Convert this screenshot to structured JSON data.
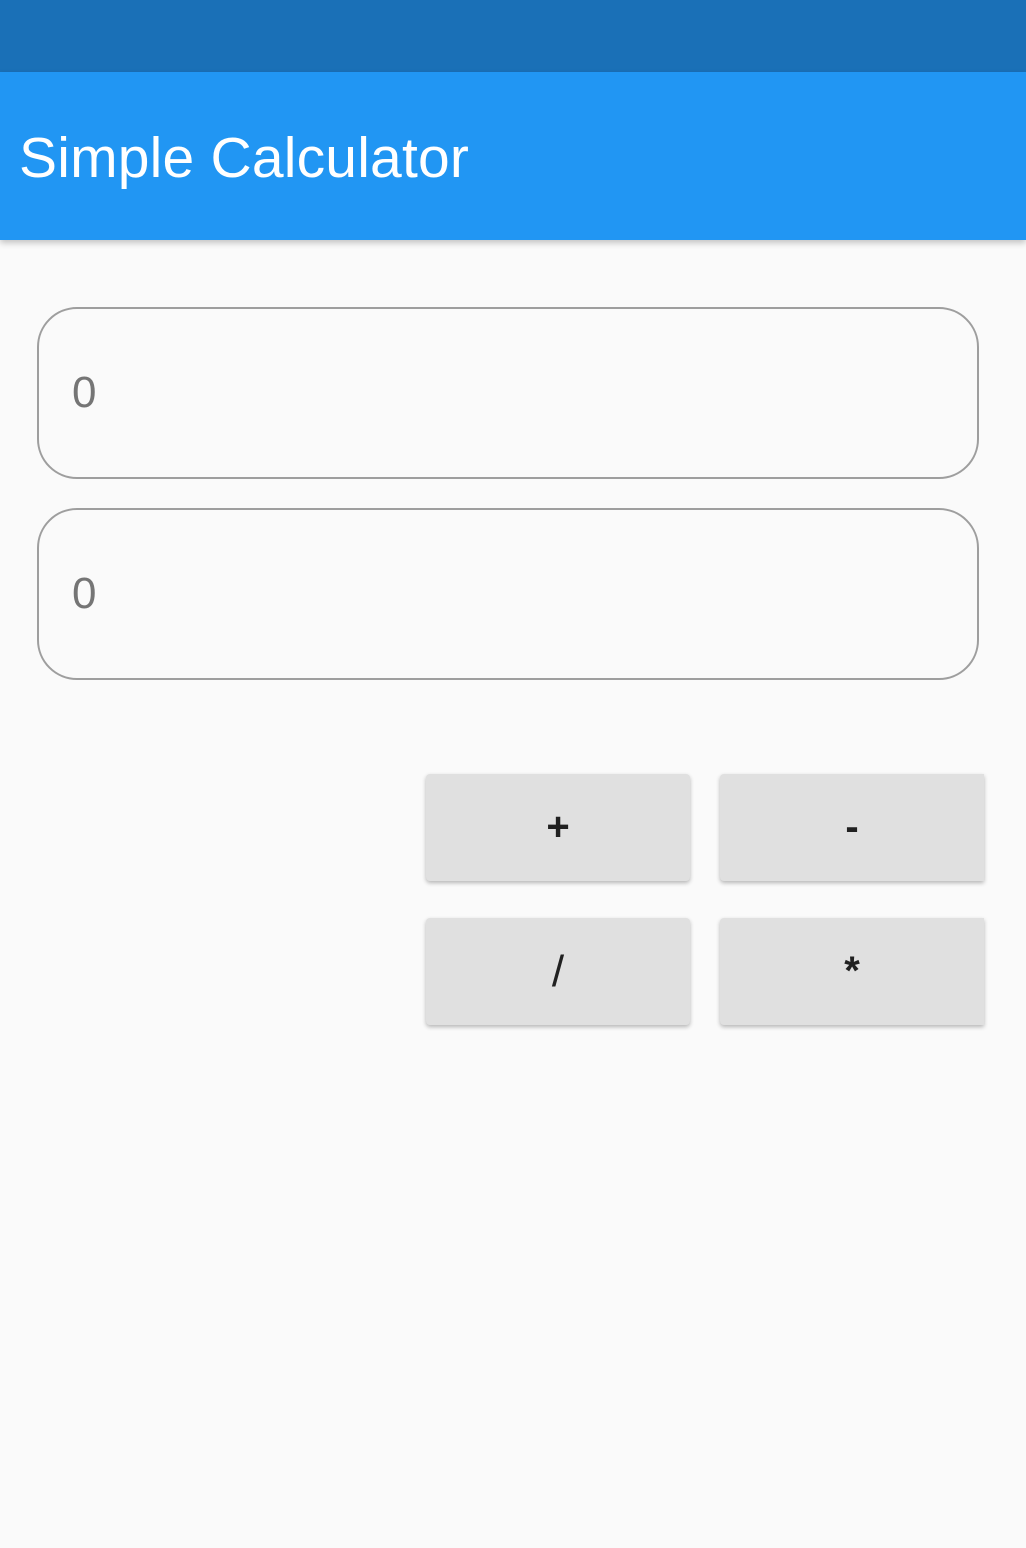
{
  "app": {
    "title": "Simple Calculator",
    "colors": {
      "status_bar": "#1a70b7",
      "app_bar": "#2196f3",
      "background": "#fafafa",
      "button": "#e0e0e0"
    }
  },
  "inputs": {
    "first_number": {
      "value": "",
      "placeholder": "0"
    },
    "second_number": {
      "value": "",
      "placeholder": "0"
    }
  },
  "operations": {
    "add_label": "+",
    "subtract_label": "-",
    "divide_label": "/",
    "multiply_label": "*"
  }
}
